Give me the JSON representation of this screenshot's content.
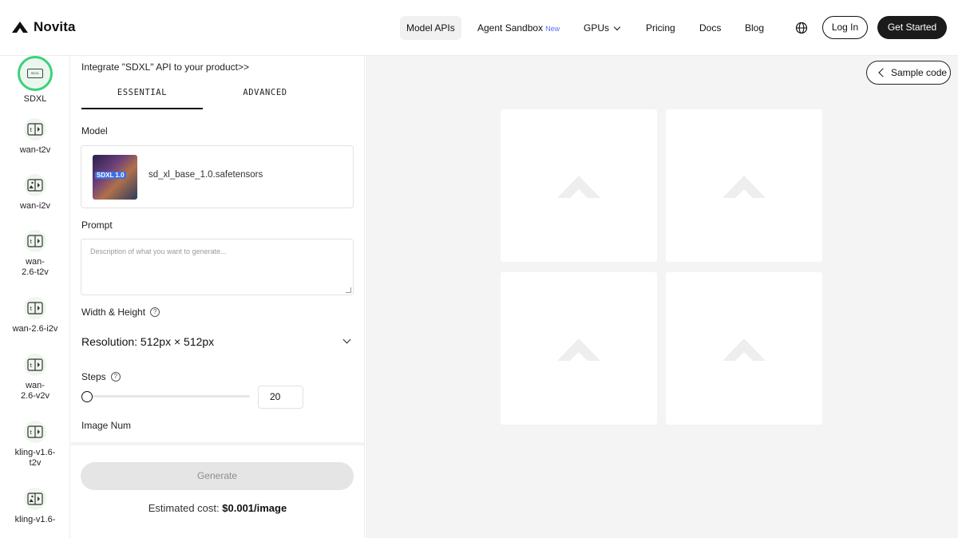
{
  "brand": {
    "name": "Novita"
  },
  "nav": {
    "items": [
      {
        "label": "Model APIs"
      },
      {
        "label": "Agent Sandbox",
        "badge": "New"
      },
      {
        "label": "GPUs"
      },
      {
        "label": "Pricing"
      },
      {
        "label": "Docs"
      },
      {
        "label": "Blog"
      }
    ],
    "login": "Log In",
    "get_started": "Get Started"
  },
  "sidebar": {
    "items": [
      {
        "label": "SDXL",
        "icon": "sdxl-chip-icon",
        "active": true
      },
      {
        "label": "wan-t2v",
        "icon": "text-to-video-icon"
      },
      {
        "label": "wan-i2v",
        "icon": "image-to-video-icon"
      },
      {
        "label": "wan-2.6-t2v",
        "icon": "text-to-video-icon"
      },
      {
        "label": "wan-2.6-i2v",
        "icon": "text-to-video-icon"
      },
      {
        "label": "wan-2.6-v2v",
        "icon": "text-to-video-icon"
      },
      {
        "label": "kling-v1.6-t2v",
        "icon": "text-to-video-icon"
      },
      {
        "label": "kling-v1.6-",
        "icon": "image-to-video-icon"
      }
    ],
    "active_chip_text": "SDXL"
  },
  "panel": {
    "integrate_text": "Integrate \"SDXL\" API to your product>>",
    "tabs": [
      {
        "label": "ESSENTIAL",
        "active": true
      },
      {
        "label": "ADVANCED",
        "active": false
      }
    ],
    "model_label": "Model",
    "model_name": "sd_xl_base_1.0.safetensors",
    "model_thumb_tag": "SDXL 1.0",
    "prompt_label": "Prompt",
    "prompt_placeholder": "Description of what you want to generate...",
    "wh_label": "Width & Height",
    "resolution": "Resolution: 512px × 512px",
    "steps_label": "Steps",
    "steps_value": "20",
    "image_num_label": "Image Num",
    "generate": "Generate",
    "cost_label": "Estimated cost:",
    "cost_value": "$0.001/image"
  },
  "preview": {
    "sample_code": "Sample code",
    "tiles": 4
  },
  "colors": {
    "accent_green": "#3dd07a",
    "new_badge": "#5b6df0",
    "dark_button": "#1b1b1b",
    "preview_bg": "#f4f4f4"
  }
}
